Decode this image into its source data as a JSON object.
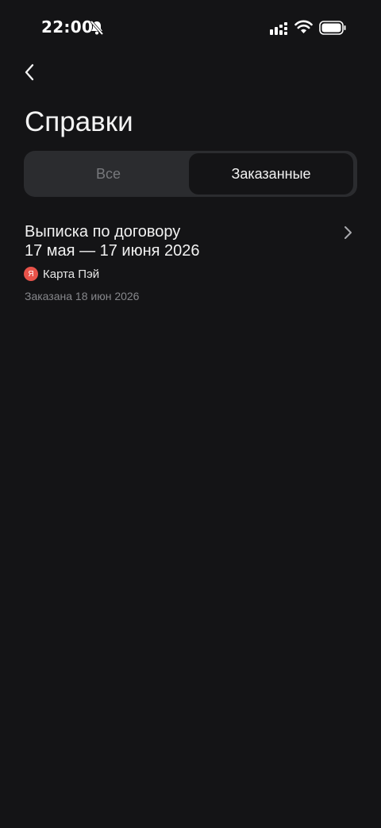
{
  "status_bar": {
    "time": "22:00",
    "icons": [
      "bell-muted-icon",
      "signal-icon",
      "wifi-icon",
      "battery-icon"
    ]
  },
  "header": {
    "back_icon": "chevron-left-icon",
    "title": "Справки"
  },
  "tabs": {
    "items": [
      {
        "label": "Все",
        "selected": false
      },
      {
        "label": "Заказанные",
        "selected": true
      }
    ]
  },
  "documents": [
    {
      "title_line1": "Выписка по договору",
      "title_line2": "17 мая — 17 июня 2026",
      "card_logo": "Я",
      "card_name": "Карта Пэй",
      "ordered_date": "Заказана 18 июн 2026"
    }
  ],
  "colors": {
    "background": "#141416",
    "segment_bg": "#2b2c2f",
    "card_logo": "#e8534a",
    "muted_text": "#86878b"
  }
}
